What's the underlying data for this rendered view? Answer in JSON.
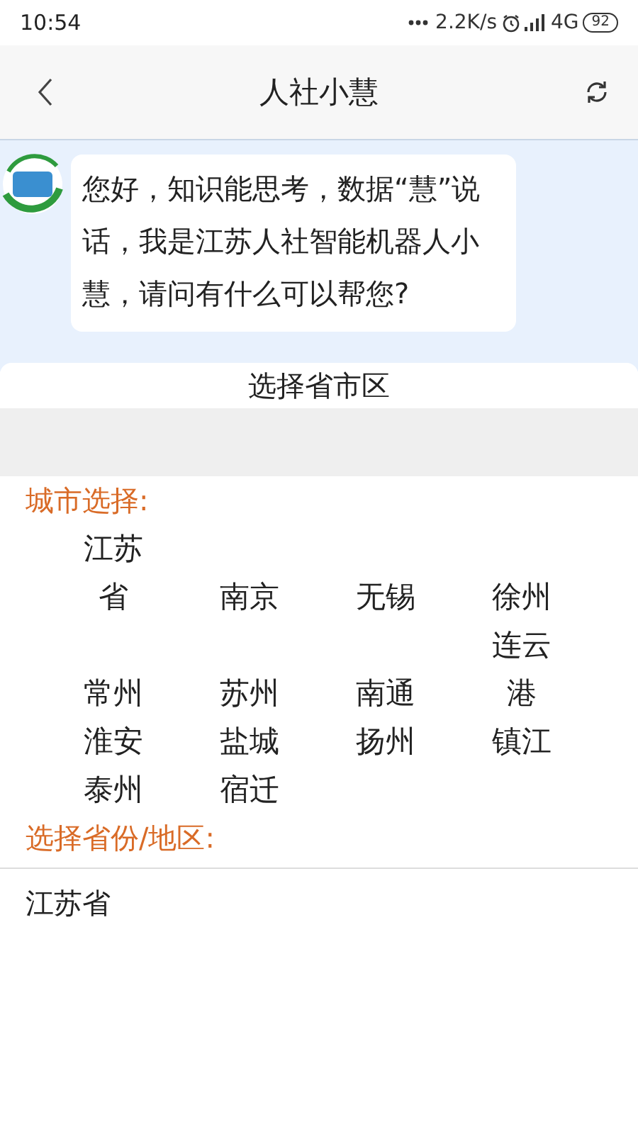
{
  "status_bar": {
    "time": "10:54",
    "speed": "2.2K/s",
    "network": "4G",
    "battery": "92"
  },
  "header": {
    "title": "人社小慧"
  },
  "chat": {
    "messages": [
      {
        "text": "您好，知识能思考，数据“慧”说话，我是江苏人社智能机器人小慧，请问有什么可以帮您?"
      }
    ]
  },
  "picker": {
    "title": "选择省市区",
    "city_label": "城市选择:",
    "cities": [
      {
        "name": "江苏省"
      },
      {
        "name": "南京"
      },
      {
        "name": "无锡"
      },
      {
        "name": "徐州"
      },
      {
        "name": "常州"
      },
      {
        "name": "苏州"
      },
      {
        "name": "南通"
      },
      {
        "name": "连云港"
      },
      {
        "name": "淮安"
      },
      {
        "name": "盐城"
      },
      {
        "name": "扬州"
      },
      {
        "name": "镇江"
      },
      {
        "name": "泰州"
      },
      {
        "name": "宿迁"
      }
    ],
    "region_label": "选择省份/地区:"
  },
  "selection": {
    "value": "江苏省"
  }
}
